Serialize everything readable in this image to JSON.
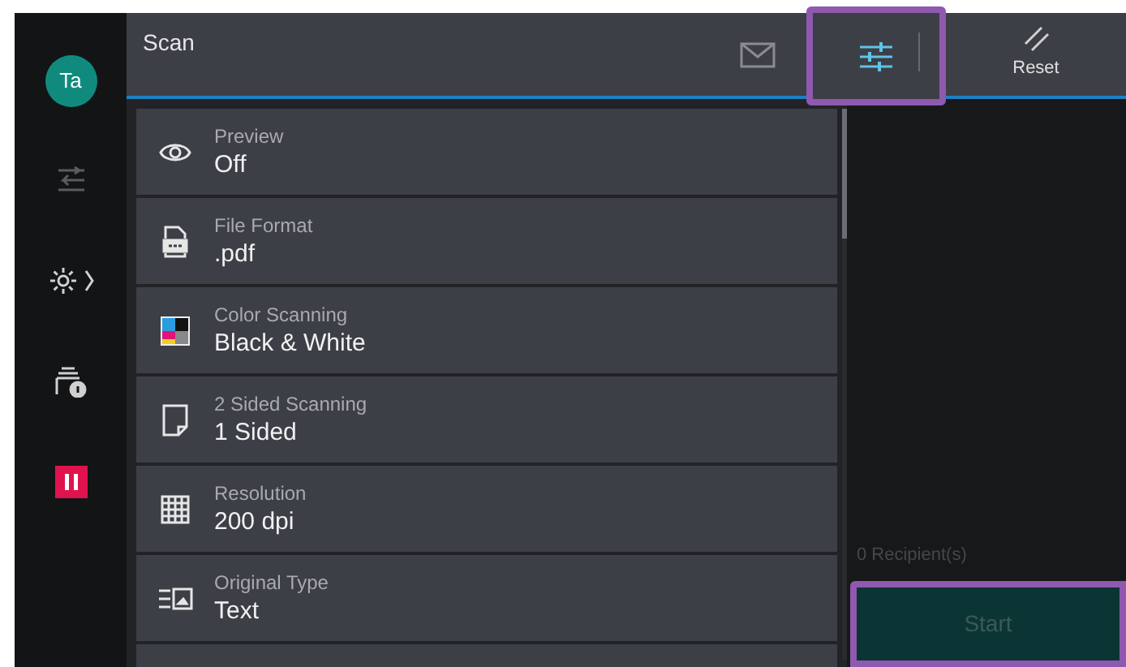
{
  "user": {
    "initials": "Ta"
  },
  "rail": [
    {
      "kind": "swap"
    },
    {
      "kind": "settings"
    },
    {
      "kind": "device-info"
    },
    {
      "kind": "stop"
    }
  ],
  "header": {
    "title": "Scan",
    "tools": [
      {
        "kind": "email",
        "highlighted": false
      },
      {
        "kind": "adjust",
        "highlighted": true
      },
      {
        "kind": "reset",
        "label": "Reset",
        "highlighted": false
      }
    ]
  },
  "settings": [
    {
      "kind": "preview",
      "label": "Preview",
      "value": "Off"
    },
    {
      "kind": "file",
      "label": "File Format",
      "value": ".pdf"
    },
    {
      "kind": "color",
      "label": "Color Scanning",
      "value": "Black & White"
    },
    {
      "kind": "sides",
      "label": "2 Sided Scanning",
      "value": "1 Sided"
    },
    {
      "kind": "resolution",
      "label": "Resolution",
      "value": "200 dpi"
    },
    {
      "kind": "original",
      "label": "Original Type",
      "value": "Text"
    }
  ],
  "recipients": "0 Recipient(s)",
  "start": {
    "label": "Start",
    "disabled": true,
    "highlighted": true
  }
}
